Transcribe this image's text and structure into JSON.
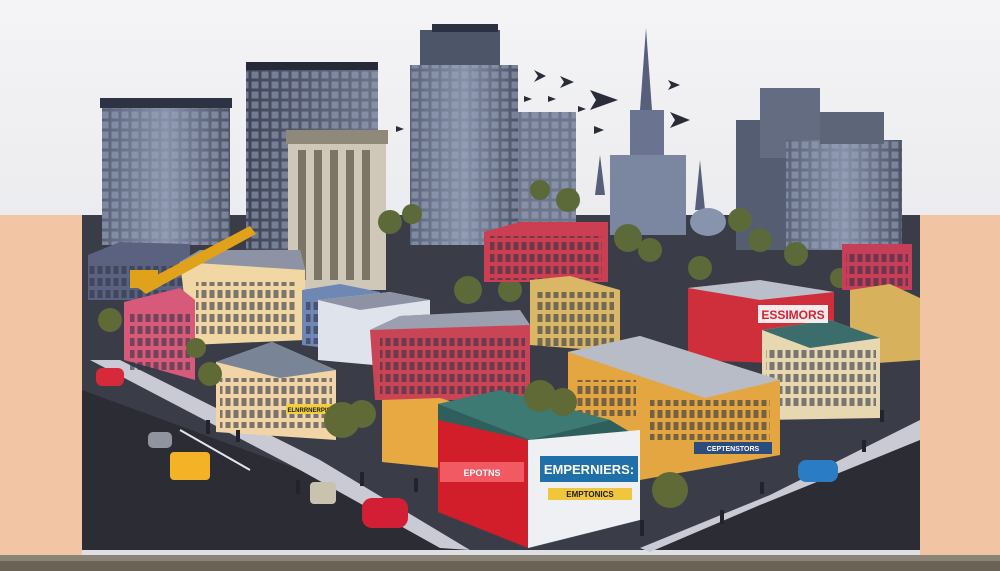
{
  "signs": {
    "big_store": "EMPERNIERS:",
    "big_store_lower": "EMPTONICS",
    "right_building": "ESSIMORS",
    "left_corner": "ELNRRNERPIS",
    "side_sign": "CEPTENSTORS",
    "small_red": "EPOTNS"
  },
  "colors": {
    "sky": "#ececef",
    "wall_left": "#f2c7a6",
    "wall_right": "#f1c6a4",
    "road": "#2c2c33",
    "sidewalk": "#cfcfd6",
    "tower_gray": "#6f7890",
    "tower_dark": "#4e5568"
  }
}
